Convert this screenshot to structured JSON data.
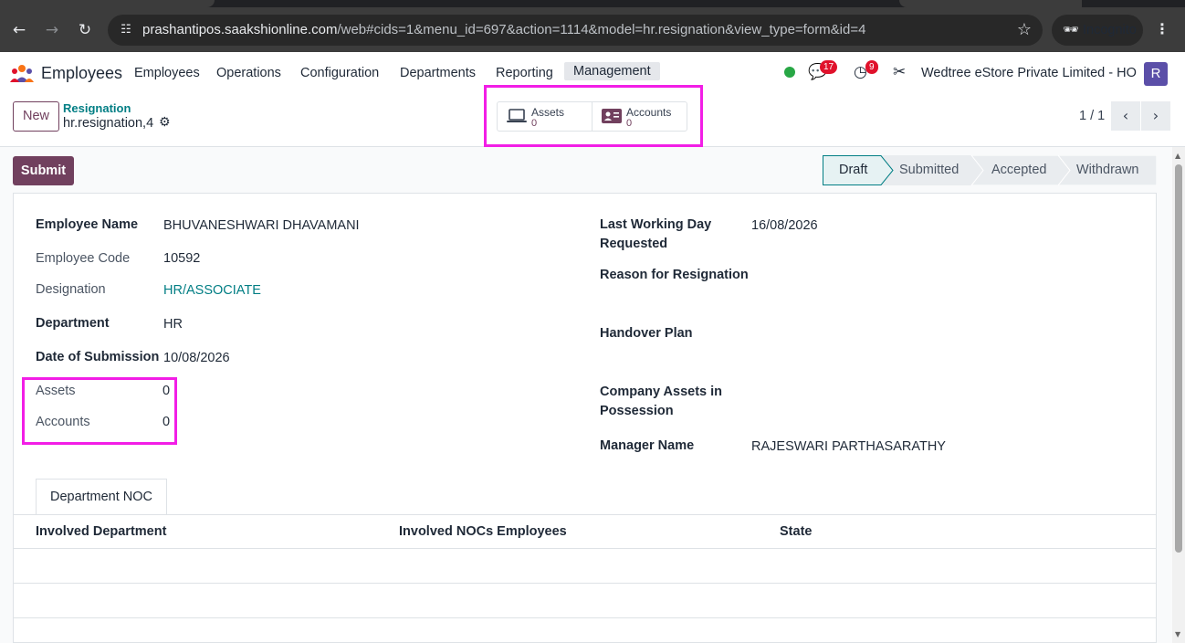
{
  "browser": {
    "url_host": "prashantipos.saakshionline.com",
    "url_rest": "/web#cids=1&menu_id=697&action=1114&model=hr.resignation&view_type=form&id=4",
    "incognito_label": "Incognito"
  },
  "navbar": {
    "app_name": "Employees",
    "menu": [
      "Employees",
      "Operations",
      "Configuration",
      "Departments",
      "Reporting",
      "Management"
    ],
    "active_menu": "Management",
    "messages_count": "17",
    "activities_count": "9",
    "company": "Wedtree eStore Private Limited - HO",
    "avatar_letter": "R",
    "colors": {
      "accent": "#71405e",
      "teal": "#017e84",
      "highlight": "#f21ee6",
      "badge": "#e0112b",
      "online": "#28a745"
    }
  },
  "control_panel": {
    "new_label": "New",
    "breadcrumb_parent": "Resignation",
    "breadcrumb_current": "hr.resignation,4",
    "smart_buttons": [
      {
        "label": "Assets",
        "value": "0",
        "icon": "laptop-icon"
      },
      {
        "label": "Accounts",
        "value": "0",
        "icon": "id-card-icon"
      }
    ],
    "pager": "1 / 1"
  },
  "form": {
    "submit_label": "Submit",
    "statuses": [
      "Draft",
      "Submitted",
      "Accepted",
      "Withdrawn"
    ],
    "current_status": "Draft",
    "left_fields": [
      {
        "label": "Employee Name",
        "value": "BHUVANESHWARI DHAVAMANI"
      },
      {
        "label": "Employee Code",
        "value": "10592"
      },
      {
        "label": "Designation",
        "value": "HR/ASSOCIATE"
      },
      {
        "label": "Department",
        "value": "HR"
      },
      {
        "label": "Date of Submission",
        "value": "10/08/2026"
      },
      {
        "label": "Assets",
        "value": "0"
      },
      {
        "label": "Accounts",
        "value": "0"
      }
    ],
    "right_fields": [
      {
        "label_line1": "Last Working Day",
        "label_line2": "Requested",
        "value": "16/08/2026"
      },
      {
        "label": "Reason for Resignation",
        "value": ""
      },
      {
        "label": "Handover Plan",
        "value": ""
      },
      {
        "label_line1": "Company Assets in",
        "label_line2": "Possession",
        "value": ""
      },
      {
        "label": "Manager Name",
        "value": "RAJESWARI PARTHASARATHY"
      }
    ],
    "tab_label": "Department NOC",
    "table_headers": [
      "Involved Department",
      "Involved NOCs Employees",
      "State"
    ]
  }
}
